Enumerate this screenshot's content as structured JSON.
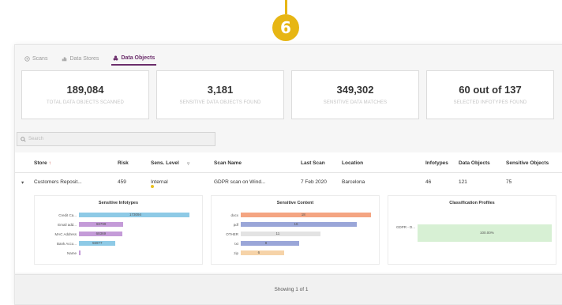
{
  "callout": {
    "number": "6"
  },
  "tabs": [
    {
      "label": "Scans",
      "icon": "target-icon"
    },
    {
      "label": "Data Stores",
      "icon": "database-icon"
    },
    {
      "label": "Data Objects",
      "icon": "objects-icon",
      "active": true
    }
  ],
  "cards": [
    {
      "value": "189,084",
      "label": "TOTAL DATA OBJECTS SCANNED"
    },
    {
      "value": "3,181",
      "label": "SENSITIVE DATA OBJECTS FOUND"
    },
    {
      "value": "349,302",
      "label": "SENSITIVE DATA MATCHES"
    },
    {
      "value": "60 out of 137",
      "label": "SELECTED INFOTYPES FOUND"
    }
  ],
  "search": {
    "placeholder": "Search"
  },
  "table": {
    "headers": {
      "store": "Store",
      "risk": "Risk",
      "sens_level": "Sens. Level",
      "scan_name": "Scan Name",
      "last_scan": "Last Scan",
      "location": "Location",
      "infotypes": "Infotypes",
      "data_objects": "Data Objects",
      "sensitive_objects": "Sensitive Objects"
    },
    "row": {
      "store": "Customers Reposit...",
      "risk": "459",
      "sens_level": "Internal",
      "scan_name": "GDPR scan on Wind...",
      "last_scan": "7 Feb 2020",
      "location": "Barcelona",
      "infotypes": "46",
      "data_objects": "121",
      "sensitive_objects": "75"
    }
  },
  "panels": {
    "infotypes": {
      "title": "Sensitive Infotypes",
      "bars": [
        {
          "label": "Credit Ca...",
          "value": 173094,
          "text": "173094",
          "color": "#8ecae6"
        },
        {
          "label": "Email add...",
          "value": 68799,
          "text": "68799",
          "color": "#c49bd8"
        },
        {
          "label": "MAC Address",
          "value": 68369,
          "text": "68369",
          "color": "#c49bd8"
        },
        {
          "label": "Bank Acco...",
          "value": 56977,
          "text": "56977",
          "color": "#8ecae6"
        },
        {
          "label": "Name",
          "value": 2500,
          "text": "",
          "color": "#c49bd8"
        }
      ],
      "max": 173094
    },
    "content": {
      "title": "Sensitive Content",
      "bars": [
        {
          "label": "docx",
          "value": 18,
          "text": "18",
          "color": "#f4a582"
        },
        {
          "label": "pdf",
          "value": 16,
          "text": "16",
          "color": "#9aa6d8"
        },
        {
          "label": "OTHER",
          "value": 11,
          "text": "11",
          "color": "#e3e3e3"
        },
        {
          "label": "txt",
          "value": 8,
          "text": "8",
          "color": "#9aa6d8"
        },
        {
          "label": "zip",
          "value": 6,
          "text": "6",
          "color": "#f6d3a8"
        }
      ],
      "max": 18.5
    },
    "profiles": {
      "title": "Classification Profiles",
      "bars": [
        {
          "label": "GDPR - D...",
          "value": 100,
          "text": "100.00%",
          "color": "#d7f0d4"
        }
      ],
      "max": 100
    }
  },
  "footer": {
    "text": "Showing 1 of 1"
  }
}
